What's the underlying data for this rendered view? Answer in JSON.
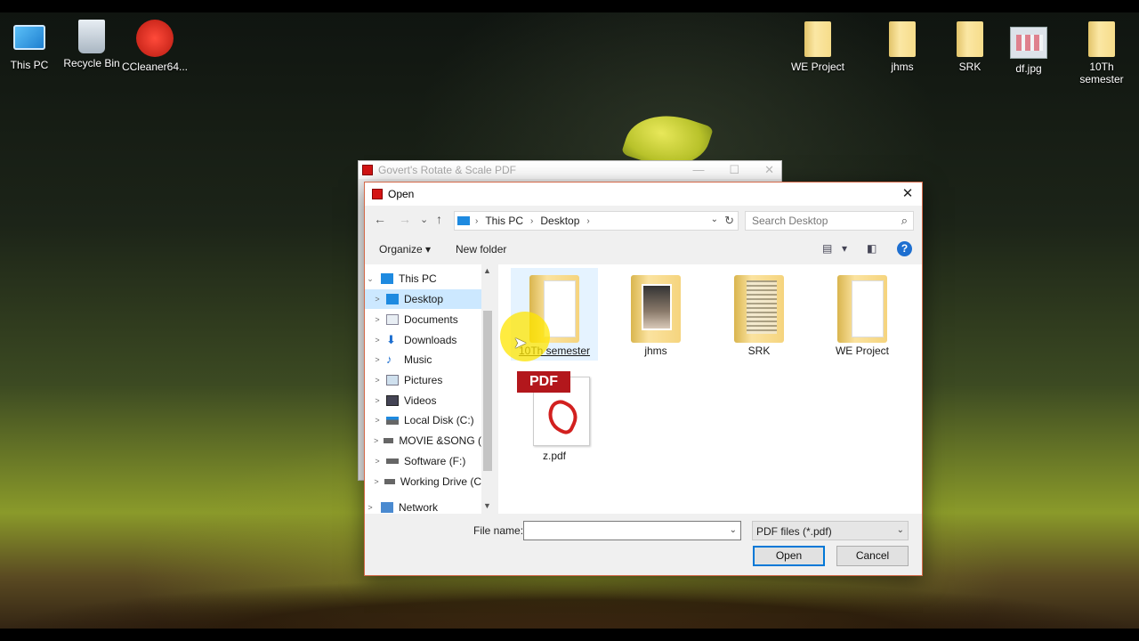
{
  "desktop": {
    "icons": [
      {
        "label": "This PC",
        "icon": "this-pc-icon"
      },
      {
        "label": "Recycle Bin",
        "icon": "recycle-bin-icon"
      },
      {
        "label": "CCleaner64...",
        "icon": "ccleaner-icon"
      },
      {
        "label": "WE Project",
        "icon": "folder-icon"
      },
      {
        "label": "jhms",
        "icon": "folder-icon"
      },
      {
        "label": "SRK",
        "icon": "folder-icon"
      },
      {
        "label": "df.jpg",
        "icon": "image-file-icon"
      },
      {
        "label": "10Th semester",
        "icon": "folder-icon"
      }
    ]
  },
  "background_window": {
    "title": "Govert's Rotate & Scale PDF",
    "controls": {
      "minimize": "—",
      "maximize": "☐",
      "close": "✕"
    }
  },
  "dialog": {
    "title": "Open",
    "close": "✕",
    "nav": {
      "back": "←",
      "forward": "→",
      "recent": "⌄",
      "up": "↑"
    },
    "address": {
      "crumbs": [
        "This PC",
        "Desktop"
      ],
      "separator": "›",
      "dropdown": "⌄",
      "refresh": "↻"
    },
    "search": {
      "placeholder": "Search Desktop"
    },
    "toolbar": {
      "organize": "Organize ▾",
      "new_folder": "New folder",
      "view_menu": "▾",
      "help": "?"
    },
    "tree": [
      {
        "label": "This PC",
        "expander": "⌄",
        "selected": false
      },
      {
        "label": "Desktop",
        "expander": ">",
        "selected": true
      },
      {
        "label": "Documents",
        "expander": ">",
        "selected": false
      },
      {
        "label": "Downloads",
        "expander": ">",
        "selected": false
      },
      {
        "label": "Music",
        "expander": ">",
        "selected": false
      },
      {
        "label": "Pictures",
        "expander": ">",
        "selected": false
      },
      {
        "label": "Videos",
        "expander": ">",
        "selected": false
      },
      {
        "label": "Local Disk (C:)",
        "expander": ">",
        "selected": false
      },
      {
        "label": "MOVIE &SONG (",
        "expander": ">",
        "selected": false
      },
      {
        "label": "Software (F:)",
        "expander": ">",
        "selected": false
      },
      {
        "label": "Working Drive (C",
        "expander": ">",
        "selected": false
      },
      {
        "label": "Network",
        "expander": ">",
        "selected": false
      }
    ],
    "files": [
      {
        "name": "10Th semester",
        "type": "folder",
        "hovered": true
      },
      {
        "name": "jhms",
        "type": "folder",
        "hovered": false
      },
      {
        "name": "SRK",
        "type": "folder",
        "hovered": false
      },
      {
        "name": "WE Project",
        "type": "folder",
        "hovered": false
      },
      {
        "name": "z.pdf",
        "type": "pdf",
        "hovered": false
      }
    ],
    "pdf_badge": "PDF",
    "file_name_label": "File name:",
    "file_name_value": "",
    "file_type_filter": "PDF files (*.pdf)",
    "open_button": "Open",
    "cancel_button": "Cancel"
  }
}
